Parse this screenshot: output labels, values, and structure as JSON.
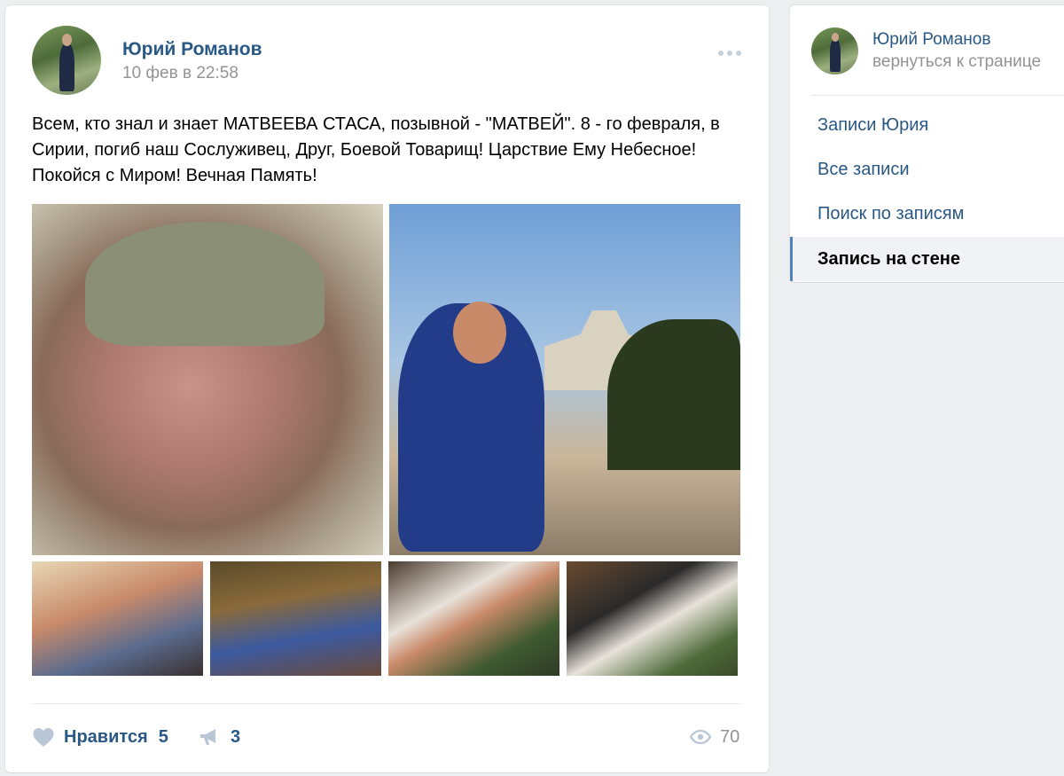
{
  "post": {
    "author": "Юрий Романов",
    "date": "10 фев в 22:58",
    "text": "Всем, кто знал и знает МАТВЕЕВА СТАСА, позывной - \"МАТВЕЙ\". 8 - го февраля, в Сирии, погиб наш Сослуживец, Друг, Боевой Товарищ! Царствие Ему Небесное! Покойся с Миром! Вечная Память!",
    "actions": {
      "like_label": "Нравится",
      "like_count": "5",
      "share_count": "3",
      "views_count": "70"
    },
    "icons": {
      "more": "more-dots-icon",
      "like": "heart-icon",
      "share": "megaphone-icon",
      "views": "eye-icon"
    }
  },
  "sidebar": {
    "name": "Юрий Романов",
    "back": "вернуться к странице",
    "menu": [
      {
        "label": "Записи Юрия"
      },
      {
        "label": "Все записи"
      },
      {
        "label": "Поиск по записям"
      },
      {
        "label": "Запись на стене"
      }
    ]
  },
  "colors": {
    "link": "#2a5885",
    "muted": "#939393",
    "page_bg": "#edeef0",
    "active_marker": "#5181b8"
  }
}
